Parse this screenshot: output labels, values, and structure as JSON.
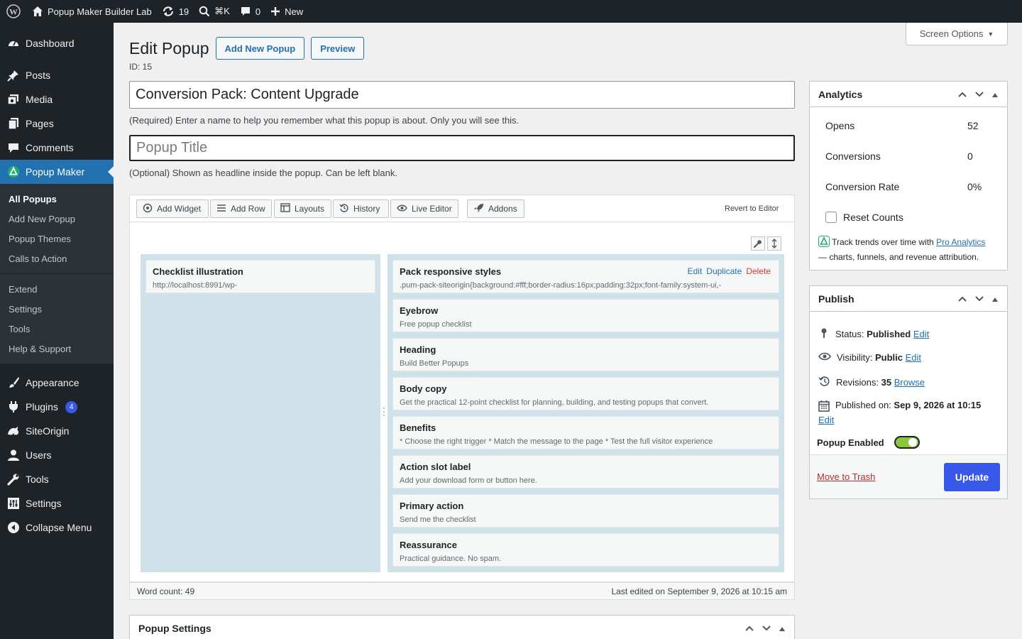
{
  "admin_bar": {
    "site_name": "Popup Maker Builder Lab",
    "updates": "19",
    "search_shortcut": "⌘K",
    "comments": "0",
    "new_label": "New"
  },
  "sidebar": {
    "items_top": [
      {
        "label": "Dashboard",
        "icon": "dashboard-icon"
      }
    ],
    "items_content": [
      {
        "label": "Posts",
        "icon": "pin-icon"
      },
      {
        "label": "Media",
        "icon": "media-icon"
      },
      {
        "label": "Pages",
        "icon": "pages-icon"
      },
      {
        "label": "Comments",
        "icon": "comment-icon"
      },
      {
        "label": "Popup Maker",
        "icon": "popup-maker-icon"
      }
    ],
    "submenu": [
      "All Popups",
      "Add New Popup",
      "Popup Themes",
      "Calls to Action"
    ],
    "submenu2": [
      "Extend",
      "Settings",
      "Tools",
      "Help & Support"
    ],
    "items_bottom": [
      {
        "label": "Appearance",
        "icon": "brush-icon"
      },
      {
        "label": "Plugins",
        "icon": "plug-icon",
        "badge": "4"
      },
      {
        "label": "SiteOrigin",
        "icon": "siteorigin-icon"
      },
      {
        "label": "Users",
        "icon": "users-icon"
      },
      {
        "label": "Tools",
        "icon": "wrench-icon"
      },
      {
        "label": "Settings",
        "icon": "settings-icon"
      },
      {
        "label": "Collapse Menu",
        "icon": "collapse-icon"
      }
    ]
  },
  "header": {
    "title": "Edit Popup",
    "add_new": "Add New Popup",
    "preview": "Preview",
    "id_label": "ID: 15",
    "screen_options": "Screen Options"
  },
  "name_field": {
    "value": "Conversion Pack: Content Upgrade",
    "help": "(Required) Enter a name to help you remember what this popup is about. Only you will see this."
  },
  "title_field": {
    "placeholder": "Popup Title",
    "help": "(Optional) Shown as headline inside the popup. Can be left blank."
  },
  "toolbar": {
    "add_widget": "Add Widget",
    "add_row": "Add Row",
    "layouts": "Layouts",
    "history": "History",
    "live_editor": "Live Editor",
    "addons": "Addons",
    "revert": "Revert to Editor"
  },
  "left_widget": {
    "title": "Checklist illustration",
    "desc": "http://localhost:8991/wp-"
  },
  "widget_actions": {
    "edit": "Edit",
    "duplicate": "Duplicate",
    "delete": "Delete"
  },
  "widgets": [
    {
      "title": "Pack responsive styles",
      "desc": ".pum-pack-siteorigin{background:#fff;border-radius:16px;padding:32px;font-family:system-ui,-"
    },
    {
      "title": "Eyebrow",
      "desc": "Free popup checklist"
    },
    {
      "title": "Heading",
      "desc": "Build Better Popups"
    },
    {
      "title": "Body copy",
      "desc": "Get the practical 12-point checklist for planning, building, and testing popups that convert."
    },
    {
      "title": "Benefits",
      "desc": "* Choose the right trigger * Match the message to the page * Test the full visitor experience"
    },
    {
      "title": "Action slot label",
      "desc": "Add your download form or button here."
    },
    {
      "title": "Primary action",
      "desc": "Send me the checklist"
    },
    {
      "title": "Reassurance",
      "desc": "Practical guidance. No spam."
    }
  ],
  "status_bar": {
    "word_count": "Word count: 49",
    "last_edited": "Last edited on September 9, 2026 at 10:15 am"
  },
  "popup_settings": {
    "title": "Popup Settings"
  },
  "analytics": {
    "title": "Analytics",
    "opens_label": "Opens",
    "opens": "52",
    "conv_label": "Conversions",
    "conv": "0",
    "rate_label": "Conversion Rate",
    "rate": "0%",
    "reset": "Reset Counts",
    "promo_pre": "Track trends over time with ",
    "promo_link": "Pro Analytics",
    "promo_post": "— charts, funnels, and revenue attribution."
  },
  "publish": {
    "title": "Publish",
    "status_label": "Status:",
    "status": "Published",
    "edit": "Edit",
    "visibility_label": "Visibility:",
    "visibility": "Public",
    "revisions_label": "Revisions:",
    "revisions": "35",
    "browse": "Browse",
    "published_label": "Published on:",
    "published": "Sep 9, 2026 at 10:15",
    "enabled_label": "Popup Enabled",
    "trash": "Move to Trash",
    "update": "Update"
  },
  "colors": {
    "accent": "#2271b1",
    "update_btn": "#3858e9",
    "toggle": "#8cc63f",
    "builder_bg": "#cfe2ea",
    "delete": "#d63638"
  }
}
